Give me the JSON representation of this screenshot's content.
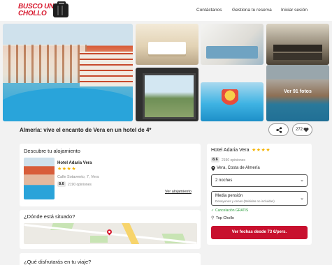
{
  "header": {
    "logo_line1": "BUSCO UN",
    "logo_line2": "CHOLLO",
    "nav": [
      "Contáctanos",
      "Gestiona tu reserva",
      "Iniciar sesión"
    ]
  },
  "gallery": {
    "more_photos": "Ver 91 fotos"
  },
  "hotel_title": "Almería: vive el encanto de Vera en un hotel de 4*",
  "likes": "272",
  "accommodation": {
    "heading": "Descubre tu alojamiento",
    "name": "Hotel Adaria Vera",
    "stars": "★★★★",
    "address": "Calle Sotavento, 7, Vera",
    "score": "8.6",
    "reviews": "2190 opiniones",
    "link": "Ver alojamiento"
  },
  "location": {
    "heading": "¿Dónde está situado?"
  },
  "enjoy": {
    "heading": "¿Qué disfrutarás en tu viaje?"
  },
  "booking": {
    "name": "Hotel Adaria Vera",
    "stars": "★★★★",
    "score": "8.6",
    "reviews": "2190 opiniones",
    "location": "Vera, Costa de Almería",
    "nights": "2 noches",
    "board": "Media pensión",
    "board_sub": "Desayunos y cenas (Bebidas no incluidas)",
    "cancel": "Cancelación GRATIS",
    "tag": "Top Chollo",
    "cta": "Ver fechas desde 73 €/pers."
  },
  "colors": {
    "brand_red": "#d7192e",
    "cta_red": "#c8102e",
    "star": "#f5b301",
    "green": "#2a9d3b"
  }
}
